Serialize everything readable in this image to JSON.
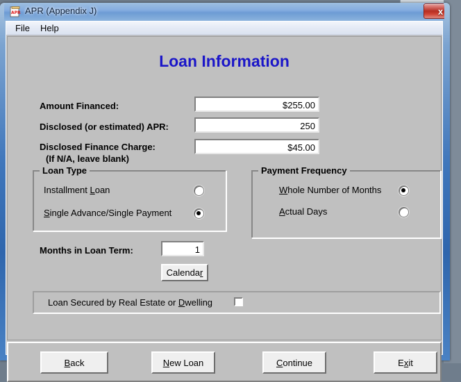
{
  "window": {
    "title": "APR (Appendix J)",
    "icon": "apr-document-icon",
    "close_label": "x",
    "accent_title_color": "#3f76bb"
  },
  "menu": {
    "items": [
      {
        "label": "File"
      },
      {
        "label": "Help"
      }
    ]
  },
  "page": {
    "heading": "Loan Information",
    "heading_color": "#1b16c8"
  },
  "fields": [
    {
      "label": "Amount Financed:",
      "value": "$255.00",
      "placeholder": ""
    },
    {
      "label": "Disclosed (or estimated) APR:",
      "value": "250",
      "placeholder": ""
    },
    {
      "label": "Disclosed Finance Charge:",
      "label_line2": "(If N/A, leave blank)",
      "value": "$45.00",
      "placeholder": ""
    }
  ],
  "loan_type": {
    "legend": "Loan Type",
    "options": [
      {
        "label": "Installment Loan",
        "mnemonic": "L",
        "selected": false
      },
      {
        "label": "Single Advance/Single Payment",
        "mnemonic": "S",
        "selected": true
      }
    ]
  },
  "payment_frequency": {
    "legend": "Payment Frequency",
    "options": [
      {
        "label": "Whole Number of Months",
        "mnemonic": "W",
        "selected": true
      },
      {
        "label": "Actual Days",
        "mnemonic": "A",
        "selected": false
      }
    ]
  },
  "loan_term": {
    "label": "Months in Loan Term:",
    "value": "1",
    "calendar_button": "Calendar",
    "calendar_mnemonic": "r"
  },
  "secured": {
    "label": "Loan Secured by Real Estate or Dwelling",
    "mnemonic": "D",
    "checked": false
  },
  "actions": [
    {
      "label": "Back",
      "mnemonic": "B"
    },
    {
      "label": "New Loan",
      "mnemonic": "N"
    },
    {
      "label": "Continue",
      "mnemonic": "C"
    },
    {
      "label": "Exit",
      "mnemonic": "x"
    }
  ]
}
